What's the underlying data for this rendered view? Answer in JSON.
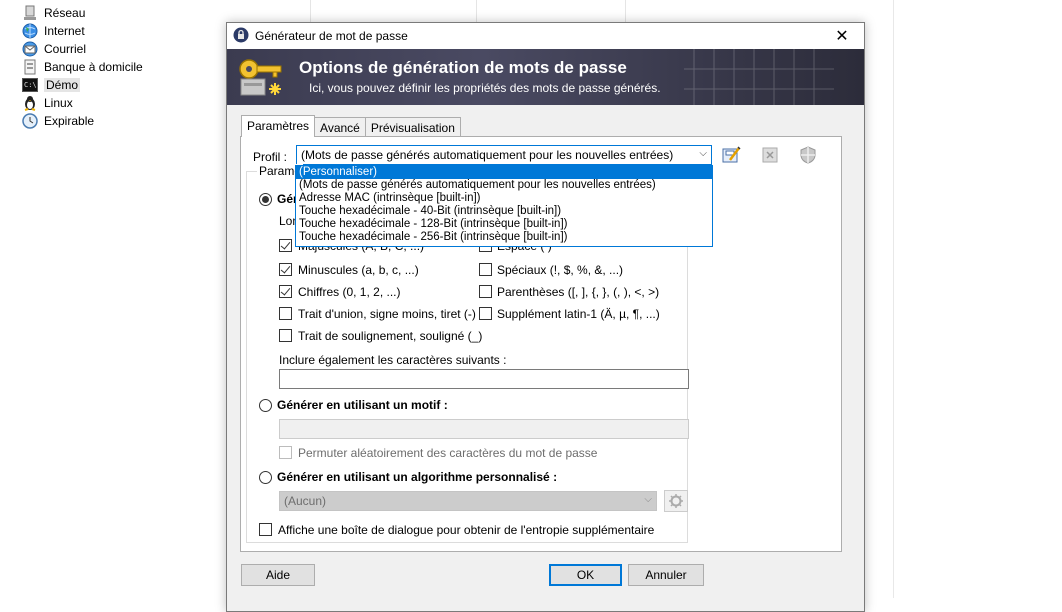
{
  "tree": {
    "items": [
      {
        "label": "Réseau",
        "icon": "network-icon"
      },
      {
        "label": "Internet",
        "icon": "globe-icon"
      },
      {
        "label": "Courriel",
        "icon": "mail-icon"
      },
      {
        "label": "Banque à domicile",
        "icon": "bank-icon"
      },
      {
        "label": "Démo",
        "icon": "terminal-icon"
      },
      {
        "label": "Linux",
        "icon": "penguin-icon"
      },
      {
        "label": "Expirable",
        "icon": "clock-icon"
      }
    ]
  },
  "dialog": {
    "title": "Générateur de mot de passe",
    "close_glyph": "✕",
    "banner_title": "Options de génération de mots de passe",
    "banner_subtitle": "Ici, vous pouvez définir les propriétés des mots de passe générés.",
    "tabs": [
      "Paramètres",
      "Avancé",
      "Prévisualisation"
    ],
    "profile_label": "Profil :",
    "profile_value": "(Mots de passe générés automatiquement pour les nouvelles entrées)",
    "profile_options": [
      "(Personnaliser)",
      "(Mots de passe générés automatiquement pour les nouvelles entrées)",
      "Adresse MAC (intrinsèque [built-in])",
      "Touche hexadécimale - 40-Bit (intrinsèque [built-in])",
      "Touche hexadécimale - 128-Bit (intrinsèque [built-in])",
      "Touche hexadécimale - 256-Bit (intrinsèque [built-in])"
    ],
    "group_legend_partial": "Paramè",
    "gen_charset_partial": "Géné",
    "length_partial": "Lon",
    "charsets_left": [
      {
        "label": "Majuscules (A, B, C, ...)",
        "checked": true
      },
      {
        "label": "Minuscules (a, b, c, ...)",
        "checked": true
      },
      {
        "label": "Chiffres (0, 1, 2, ...)",
        "checked": true
      },
      {
        "label": "Trait d'union, signe moins, tiret (-)",
        "checked": false
      },
      {
        "label": "Trait de soulignement, souligné (_)",
        "checked": false
      }
    ],
    "charsets_right": [
      {
        "label": "Espace ( )",
        "checked": false
      },
      {
        "label": "Spéciaux (!, $, %, &, ...)",
        "checked": false
      },
      {
        "label": "Parenthèses ([, ], {, }, (, ), <, >)",
        "checked": false
      },
      {
        "label": "Supplément latin-1 (Ä, µ, ¶, ...)",
        "checked": false
      }
    ],
    "also_include_label": "Inclure également les caractères suivants :",
    "pattern_label": "Générer en utilisant un motif :",
    "permute_label": "Permuter aléatoirement des caractères du mot de passe",
    "custom_algo_label": "Générer en utilisant un algorithme personnalisé :",
    "custom_algo_value": "(Aucun)",
    "entropy_label": "Affiche une boîte de dialogue pour obtenir de l'entropie supplémentaire",
    "help_button": "Aide",
    "ok_button": "OK",
    "cancel_button": "Annuler"
  }
}
